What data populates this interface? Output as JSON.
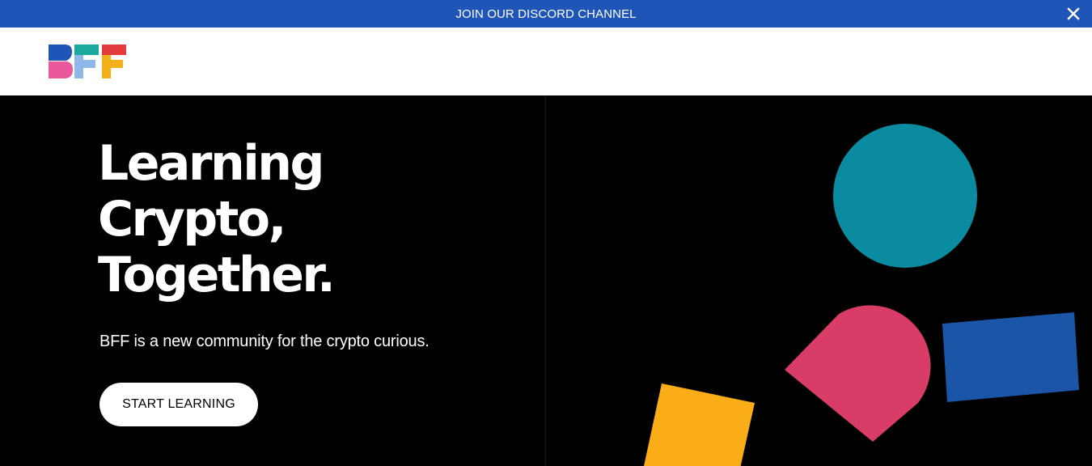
{
  "banner": {
    "text": "JOIN OUR DISCORD CHANNEL",
    "background": "#1f55b7"
  },
  "header": {
    "logo": {
      "text": "BFF",
      "colors": [
        "#1f55b7",
        "#e8589a",
        "#1aa89f",
        "#8fb8e8",
        "#f4b01b",
        "#e33b3b"
      ]
    }
  },
  "hero": {
    "headline": [
      "Learning",
      "Crypto,",
      "Together."
    ],
    "subtitle": "BFF is a new community for the crypto curious.",
    "cta_label": "START LEARNING",
    "shape_colors": {
      "circle": "#0a8b9f",
      "arch": "#d93c66",
      "rectangle": "#1a55a8",
      "square": "#fbad18"
    }
  }
}
